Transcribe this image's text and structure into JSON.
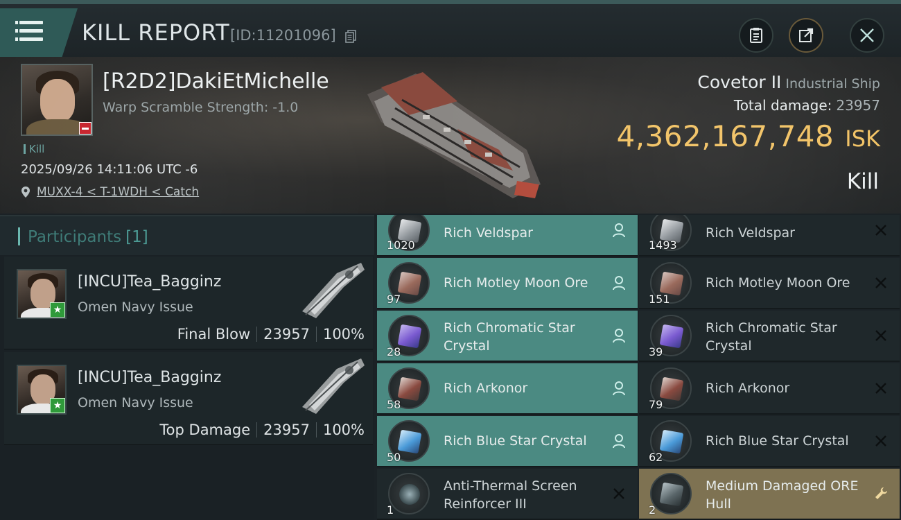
{
  "header": {
    "title": "KILL REPORT",
    "report_id": "[ID:11201096]"
  },
  "victim": {
    "name": "[R2D2]DakiEtMichelle",
    "warp_scramble": "Warp Scramble Strength: -1.0",
    "tag": "Kill",
    "datetime": "2025/09/26 14:11:06 UTC -6",
    "location": "MUXX-4 < T-1WDH < Catch",
    "ship_name": "Covetor II",
    "ship_class": "Industrial Ship",
    "total_damage_label": "Total damage:",
    "total_damage": "23957",
    "isk_value": "4,362,167,748",
    "isk_unit": "ISK",
    "status": "Kill"
  },
  "participants": {
    "title": "Participants",
    "count": "[1]",
    "rows": [
      {
        "name": "[INCU]Tea_Bagginz",
        "ship": "Omen Navy Issue",
        "role": "Final Blow",
        "damage": "23957",
        "percent": "100%"
      },
      {
        "name": "[INCU]Tea_Bagginz",
        "ship": "Omen Navy Issue",
        "role": "Top Damage",
        "damage": "23957",
        "percent": "100%"
      }
    ]
  },
  "loot": {
    "left": [
      {
        "qty": "1020",
        "name": "Rich Veldspar",
        "state": "dropped"
      },
      {
        "qty": "97",
        "name": "Rich Motley Moon Ore",
        "state": "dropped"
      },
      {
        "qty": "28",
        "name": "Rich Chromatic Star Crystal",
        "state": "dropped"
      },
      {
        "qty": "58",
        "name": "Rich Arkonor",
        "state": "dropped"
      },
      {
        "qty": "50",
        "name": "Rich Blue Star Crystal",
        "state": "dropped"
      },
      {
        "qty": "1",
        "name": "Anti-Thermal Screen Reinforcer III",
        "state": "destroyed"
      }
    ],
    "right": [
      {
        "qty": "1493",
        "name": "Rich Veldspar",
        "state": "destroyed"
      },
      {
        "qty": "151",
        "name": "Rich Motley Moon Ore",
        "state": "destroyed"
      },
      {
        "qty": "39",
        "name": "Rich Chromatic Star Crystal",
        "state": "destroyed"
      },
      {
        "qty": "79",
        "name": "Rich Arkonor",
        "state": "destroyed"
      },
      {
        "qty": "62",
        "name": "Rich Blue Star Crystal",
        "state": "destroyed"
      },
      {
        "qty": "2",
        "name": "Medium Damaged ORE Hull",
        "state": "fitted"
      }
    ]
  },
  "colors": {
    "accent_teal": "#4b8a82",
    "isk_gold": "#f2c263",
    "fitted_gold": "#7e7252",
    "negative_red": "#c8232c",
    "positive_green": "#2f9a3a"
  },
  "icons": {
    "menu": "hamburger-icon",
    "copy": "copy-icon",
    "clipboard": "clipboard-icon",
    "share": "share-icon",
    "close": "close-icon",
    "location": "location-pin-icon",
    "dropped_status": "person-icon",
    "destroyed_status": "x-icon",
    "fitted_status": "wrench-icon"
  }
}
